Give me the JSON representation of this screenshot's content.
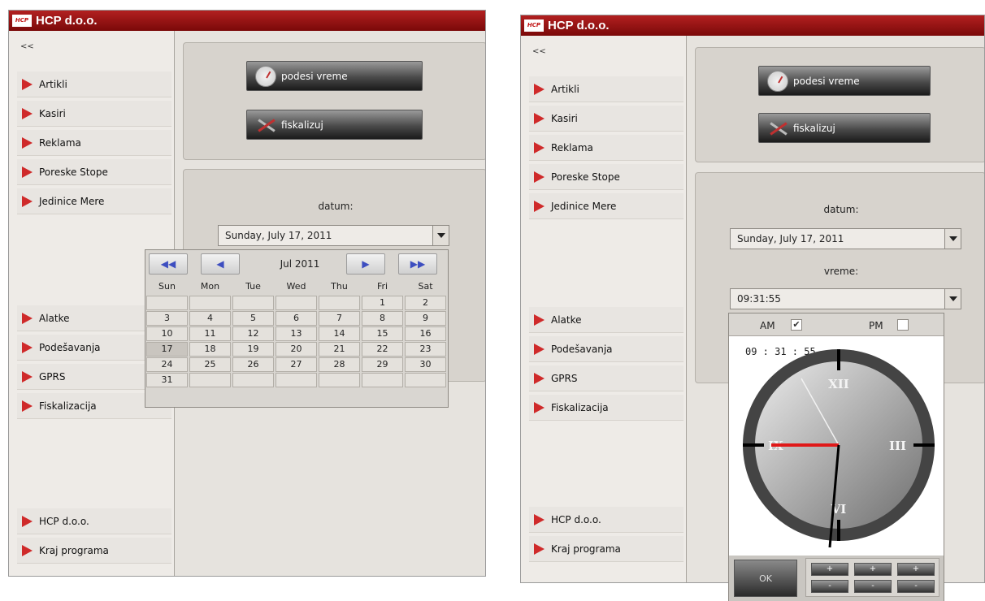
{
  "app": {
    "title": "HCP d.o.o.",
    "logo": "HCP",
    "accent": "#b22020"
  },
  "sidebar": {
    "collapse_label": "<<",
    "top_items": [
      "Artikli",
      "Kasiri",
      "Reklama",
      "Poreske Stope",
      "Jedinice Mere"
    ],
    "mid_items": [
      "Alatke",
      "Podešavanja",
      "GPRS",
      "Fiskalizacija"
    ],
    "bottom_items": [
      "HCP d.o.o.",
      "Kraj programa"
    ]
  },
  "buttons": {
    "set_time": "podesi vreme",
    "fiscalize": "fiskalizuj"
  },
  "datum": {
    "label": "datum:",
    "value": "Sunday, July 17, 2011"
  },
  "vreme": {
    "label": "vreme:",
    "value": "09:31:55"
  },
  "calendar": {
    "month_label": "Jul 2011",
    "weekdays": [
      "Sun",
      "Mon",
      "Tue",
      "Wed",
      "Thu",
      "Fri",
      "Sat"
    ],
    "weeks": [
      [
        "",
        "",
        "",
        "",
        "",
        "1",
        "2"
      ],
      [
        "3",
        "4",
        "5",
        "6",
        "7",
        "8",
        "9"
      ],
      [
        "10",
        "11",
        "12",
        "13",
        "14",
        "15",
        "16"
      ],
      [
        "17",
        "18",
        "19",
        "20",
        "21",
        "22",
        "23"
      ],
      [
        "24",
        "25",
        "26",
        "27",
        "28",
        "29",
        "30"
      ],
      [
        "31",
        "",
        "",
        "",
        "",
        "",
        ""
      ]
    ],
    "selected_day": "17"
  },
  "clock": {
    "am_label": "AM",
    "pm_label": "PM",
    "am_checked": true,
    "pm_checked": false,
    "time_readout": "09 : 31 : 55",
    "numerals": [
      "XII",
      "III",
      "VI",
      "IX"
    ],
    "ok_label": "OK",
    "plus_label": "+",
    "minus_label": "-"
  }
}
